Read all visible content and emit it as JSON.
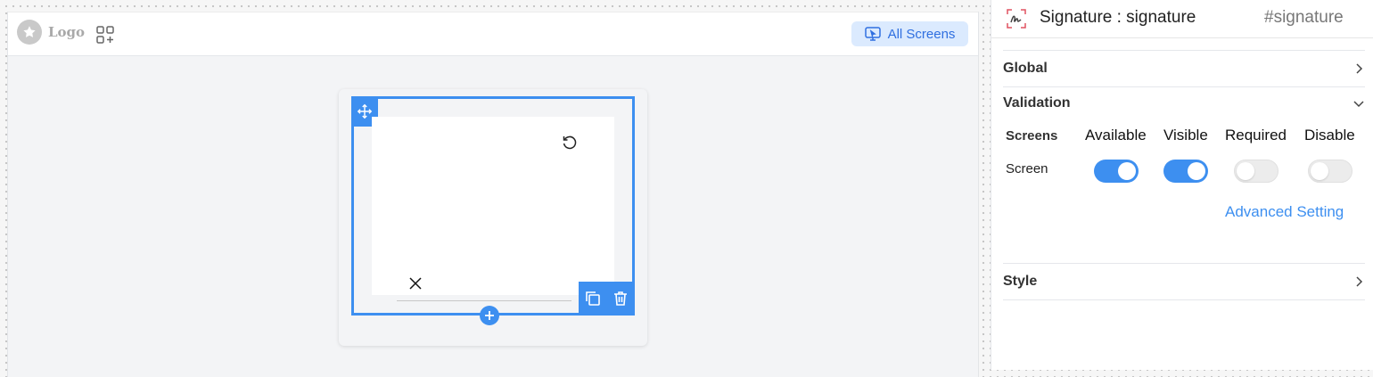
{
  "canvas": {
    "logo_text": "Logo",
    "all_screens_label": "All Screens",
    "accent_color": "#3d8ff0"
  },
  "panel": {
    "title": "Signature : signature",
    "id": "#signature",
    "sections": {
      "global": "Global",
      "validation": "Validation",
      "style": "Style"
    },
    "validation": {
      "headers": [
        "Screens",
        "Available",
        "Visible",
        "Required",
        "Disable"
      ],
      "rows": [
        {
          "screen": "Screen",
          "available": true,
          "visible": true,
          "required": false,
          "disable": false
        }
      ],
      "advanced_setting": "Advanced Setting"
    }
  }
}
